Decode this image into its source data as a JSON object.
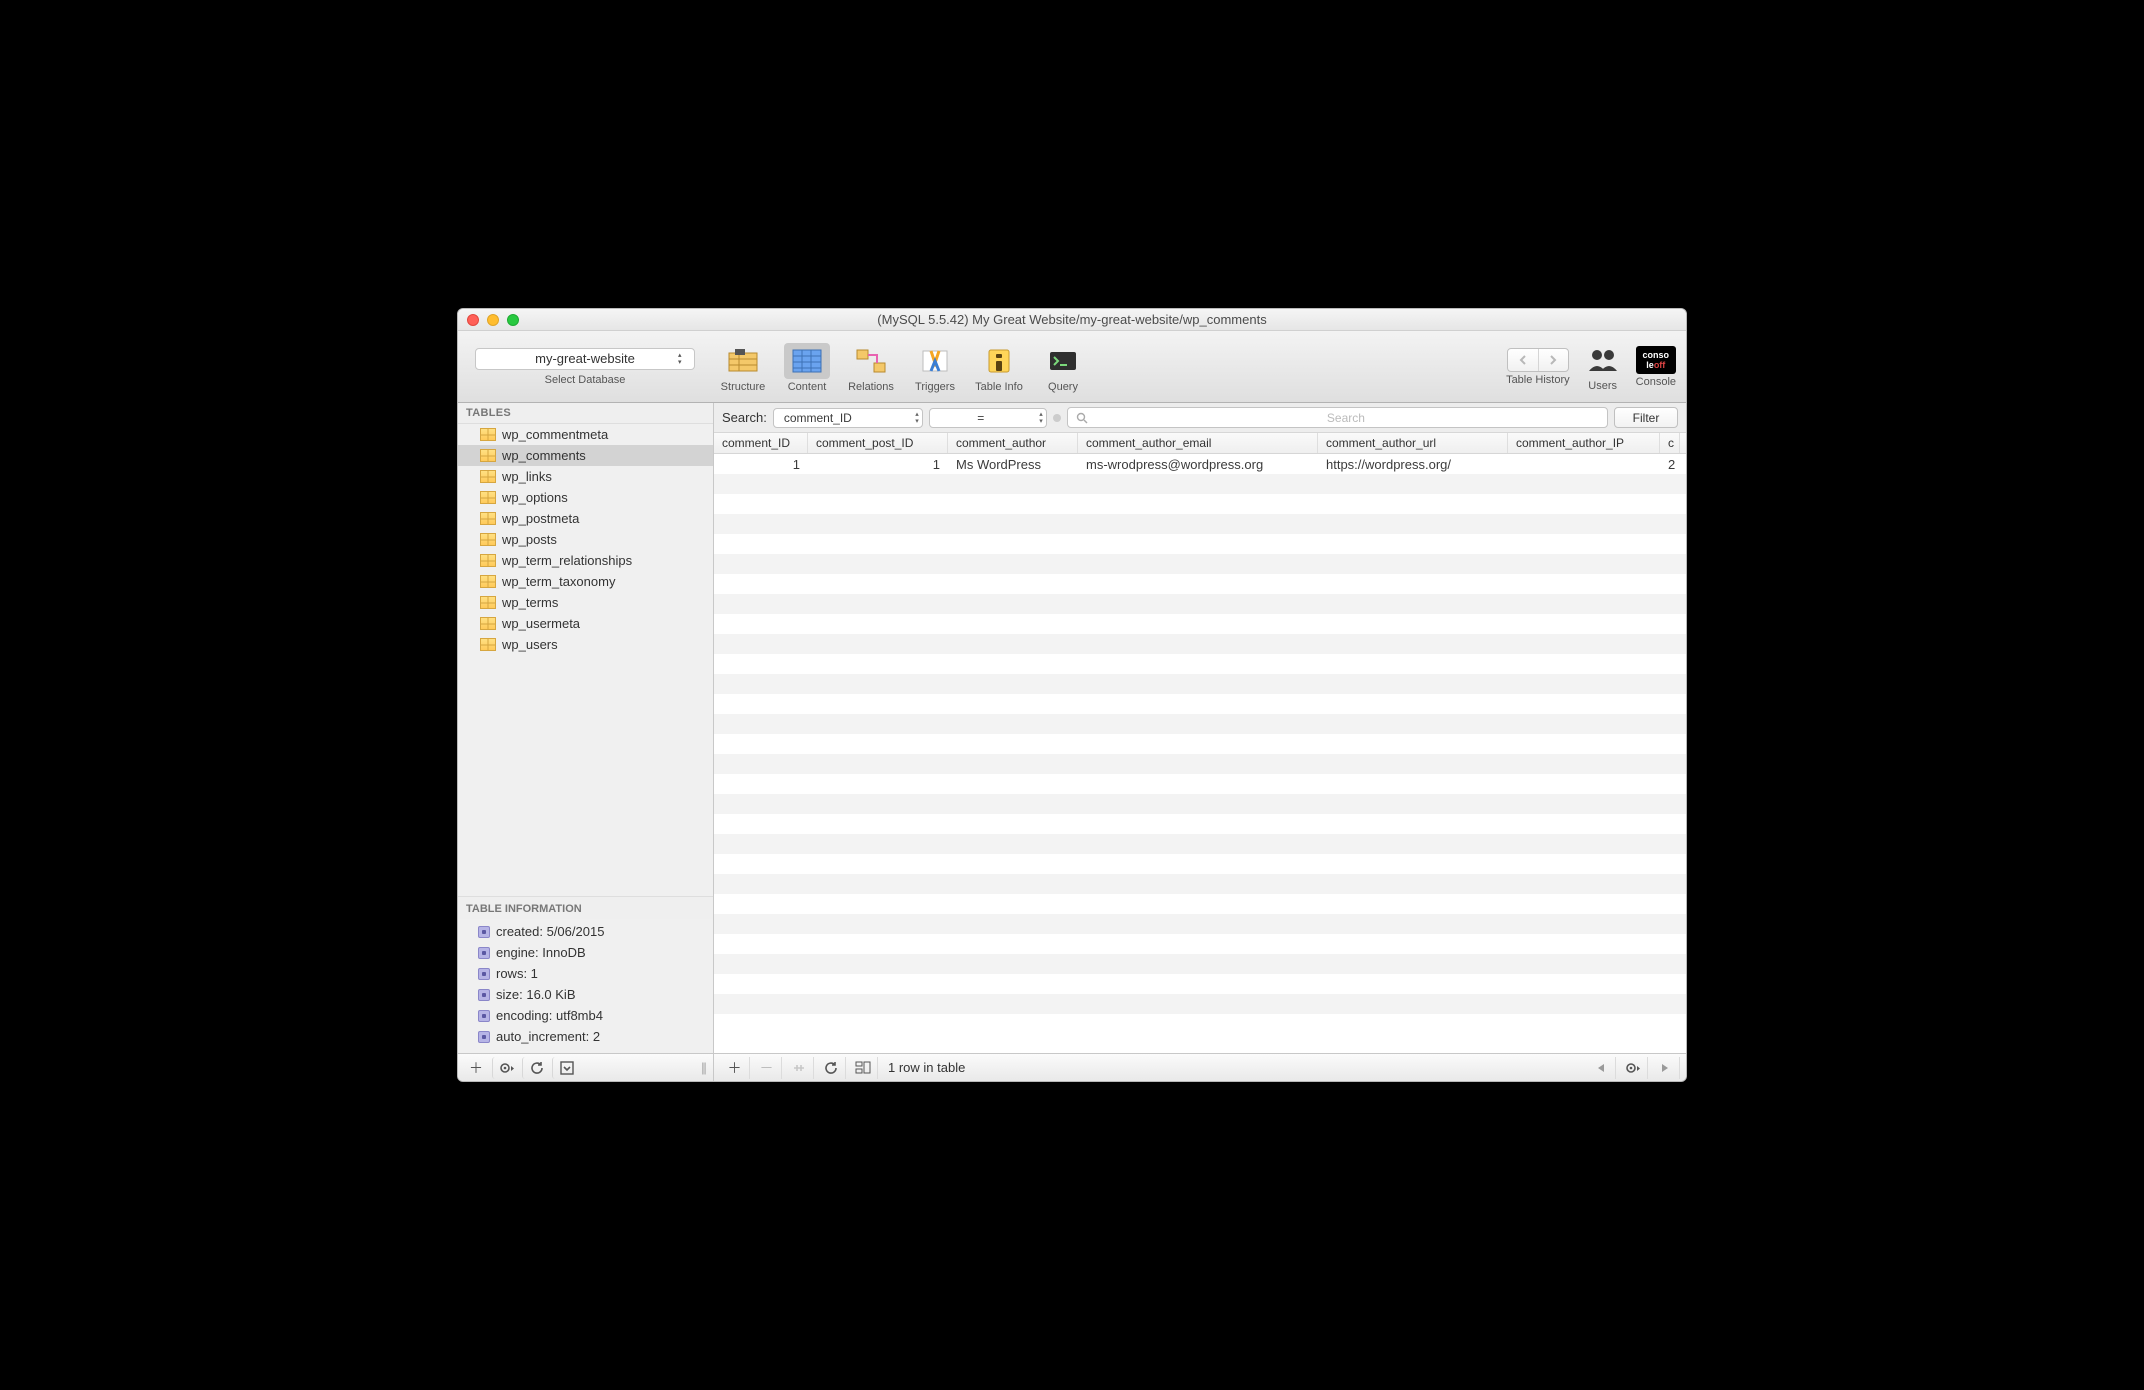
{
  "window": {
    "title": "(MySQL 5.5.42) My Great Website/my-great-website/wp_comments"
  },
  "toolbar": {
    "database_selector_value": "my-great-website",
    "database_selector_caption": "Select Database",
    "tabs": {
      "structure": "Structure",
      "content": "Content",
      "relations": "Relations",
      "triggers": "Triggers",
      "table_info": "Table Info",
      "query": "Query"
    },
    "right": {
      "table_history": "Table History",
      "users": "Users",
      "console": "Console",
      "console_box_top": "conso",
      "console_box_bottom_a": "le",
      "console_box_bottom_b": "off"
    }
  },
  "sidebar": {
    "header": "TABLES",
    "tables": [
      "wp_commentmeta",
      "wp_comments",
      "wp_links",
      "wp_options",
      "wp_postmeta",
      "wp_posts",
      "wp_term_relationships",
      "wp_term_taxonomy",
      "wp_terms",
      "wp_usermeta",
      "wp_users"
    ],
    "selected_index": 1,
    "info_header": "TABLE INFORMATION",
    "info": [
      "created: 5/06/2015",
      "engine: InnoDB",
      "rows: 1",
      "size: 16.0 KiB",
      "encoding: utf8mb4",
      "auto_increment: 2"
    ]
  },
  "search": {
    "label": "Search:",
    "column": "comment_ID",
    "operator": "=",
    "placeholder": "Search",
    "filter_button": "Filter"
  },
  "grid": {
    "columns": [
      "comment_ID",
      "comment_post_ID",
      "comment_author",
      "comment_author_email",
      "comment_author_url",
      "comment_author_IP",
      "c"
    ],
    "rows": [
      {
        "comment_ID": "1",
        "comment_post_ID": "1",
        "comment_author": "Ms WordPress",
        "comment_author_email": "ms-wrodpress@wordpress.org",
        "comment_author_url": "https://wordpress.org/",
        "comment_author_IP": "",
        "extra": "2"
      }
    ]
  },
  "footer": {
    "status": "1 row in table"
  }
}
